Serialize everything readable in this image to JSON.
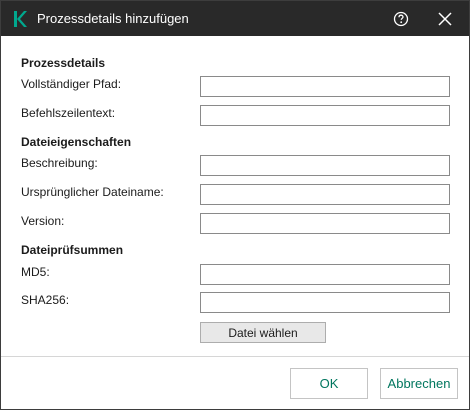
{
  "window": {
    "title": "Prozessdetails hinzufügen",
    "logo_icon": "kaspersky-k-logo",
    "accent_color": "#00a88e"
  },
  "sections": {
    "process": {
      "heading": "Prozessdetails",
      "full_path_label": "Vollständiger Pfad:",
      "full_path_value": "",
      "command_line_label": "Befehlszeilentext:",
      "command_line_value": ""
    },
    "file_properties": {
      "heading": "Dateieigenschaften",
      "description_label": "Beschreibung:",
      "description_value": "",
      "original_name_label": "Ursprünglicher Dateiname:",
      "original_name_value": "",
      "version_label": "Version:",
      "version_value": ""
    },
    "checksums": {
      "heading": "Dateiprüfsummen",
      "md5_label": "MD5:",
      "md5_value": "",
      "sha256_label": "SHA256:",
      "sha256_value": ""
    }
  },
  "buttons": {
    "choose_file": "Datei wählen",
    "ok": "OK",
    "cancel": "Abbrechen"
  }
}
